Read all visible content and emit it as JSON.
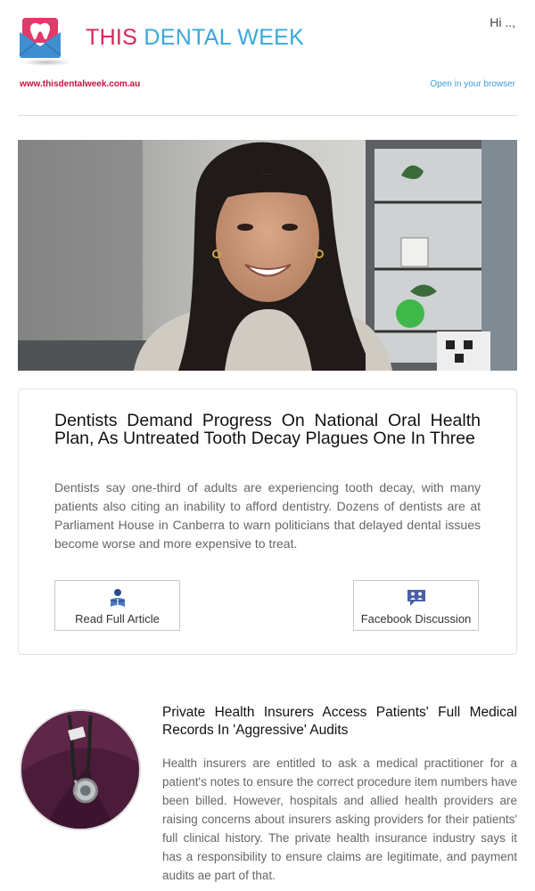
{
  "header": {
    "brand_this": "THIS",
    "brand_rest": "DENTAL WEEK",
    "greeting": "Hi ..,",
    "site_url": "www.thisdentalweek.com.au",
    "open_browser": "Open in your browser"
  },
  "colors": {
    "brand_pink": "#d4275a",
    "brand_blue": "#39a7da",
    "link_red": "#c8103e",
    "link_blue": "#3b9fd8",
    "fb_icon": "#4a5fa8"
  },
  "feature": {
    "title": "Dentists Demand Progress On National Oral Health Plan, As Untreated Tooth Decay Plagues One In Three",
    "summary": "Dentists say one-third of adults are experiencing tooth decay, with many patients also citing an inability to afford dentistry. Dozens of dentists are at Parliament House in Canberra to warn politicians that delayed dental issues become worse and more expensive to treat.",
    "read_label": "Read Full Article",
    "read_icon": "reader-icon",
    "facebook_label": "Facebook Discussion",
    "facebook_icon": "discussion-icon"
  },
  "article2": {
    "title": "Private Health Insurers Access Patients' Full Medical Records In 'Aggressive' Audits",
    "summary": "Health insurers are entitled to ask a medical practitioner for a patient's notes to ensure the correct procedure item numbers have been billed. However, hospitals and allied health providers are raising concerns about insurers asking providers for their patients' full clinical history. The private health insurance industry says it has a responsibility to ensure claims are legitimate, and payment audits ae part of that."
  }
}
